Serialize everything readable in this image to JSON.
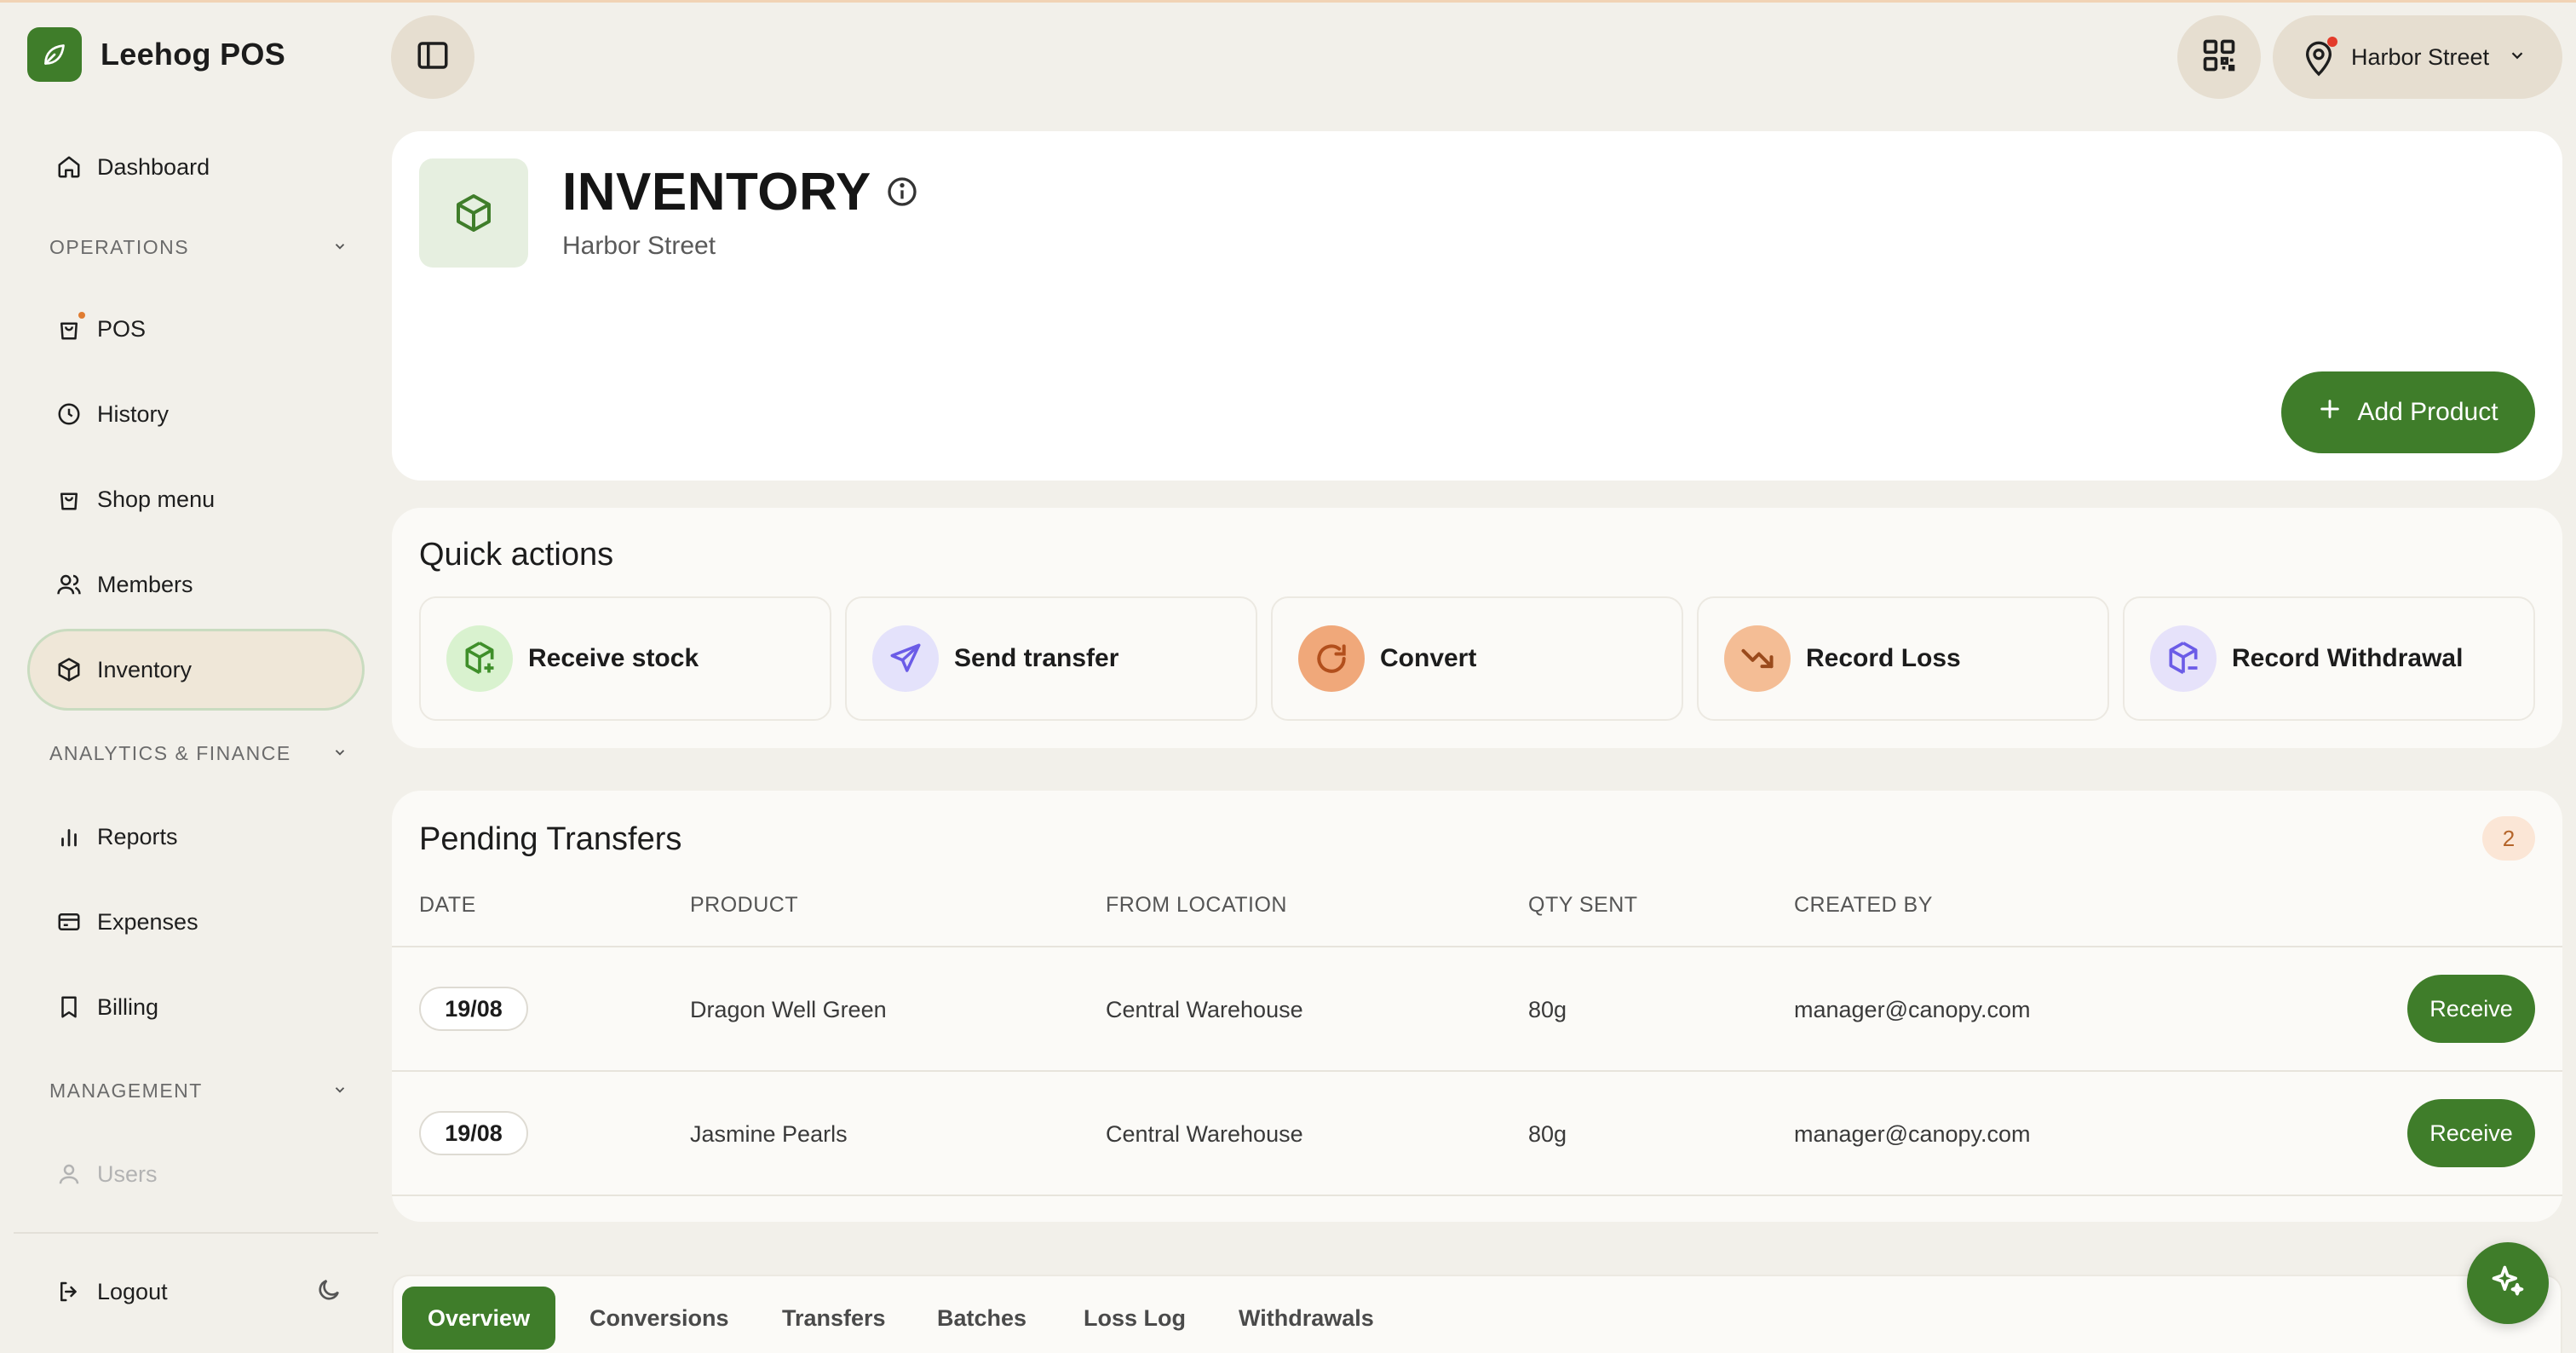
{
  "app": {
    "name": "Leehog POS",
    "brand_color": "#3f7d2a"
  },
  "sidebar": {
    "dashboard": "Dashboard",
    "operations": {
      "label": "OPERATIONS",
      "items": [
        {
          "label": "POS",
          "icon": "shopping-bag-icon"
        },
        {
          "label": "History",
          "icon": "clock-icon"
        },
        {
          "label": "Shop menu",
          "icon": "shopping-bag-icon"
        },
        {
          "label": "Members",
          "icon": "users-icon"
        },
        {
          "label": "Inventory",
          "icon": "box-icon",
          "active": true
        }
      ]
    },
    "analytics": {
      "label": "ANALYTICS & FINANCE",
      "items": [
        {
          "label": "Reports",
          "icon": "bar-chart-icon"
        },
        {
          "label": "Expenses",
          "icon": "credit-card-icon"
        },
        {
          "label": "Billing",
          "icon": "bookmark-icon"
        }
      ]
    },
    "management": {
      "label": "MANAGEMENT",
      "items": [
        {
          "label": "Users",
          "icon": "user-icon",
          "disabled": true
        }
      ]
    },
    "logout": "Logout"
  },
  "topbar": {
    "location": "Harbor Street"
  },
  "header": {
    "title": "INVENTORY",
    "subtitle": "Harbor Street",
    "add_product": "Add Product"
  },
  "quick_actions": {
    "title": "Quick actions",
    "items": [
      {
        "label": "Receive stock",
        "icon": "box-plus-icon",
        "color": "#d9f2cf"
      },
      {
        "label": "Send transfer",
        "icon": "send-icon",
        "color": "#e4e2fb"
      },
      {
        "label": "Convert",
        "icon": "rotate-icon",
        "color": "#f0a87a"
      },
      {
        "label": "Record Loss",
        "icon": "trending-down-icon",
        "color": "#f4bd95"
      },
      {
        "label": "Record Withdrawal",
        "icon": "box-minus-icon",
        "color": "#e6e2fa"
      }
    ]
  },
  "pending_transfers": {
    "title": "Pending Transfers",
    "count": "2",
    "columns": [
      "DATE",
      "PRODUCT",
      "FROM LOCATION",
      "QTY SENT",
      "CREATED BY"
    ],
    "rows": [
      {
        "date": "19/08",
        "product": "Dragon Well Green",
        "from": "Central Warehouse",
        "qty": "80g",
        "created_by": "manager@canopy.com",
        "action": "Receive"
      },
      {
        "date": "19/08",
        "product": "Jasmine Pearls",
        "from": "Central Warehouse",
        "qty": "80g",
        "created_by": "manager@canopy.com",
        "action": "Receive"
      }
    ]
  },
  "tabs": [
    "Overview",
    "Conversions",
    "Transfers",
    "Batches",
    "Loss Log",
    "Withdrawals"
  ],
  "active_tab": "Overview"
}
